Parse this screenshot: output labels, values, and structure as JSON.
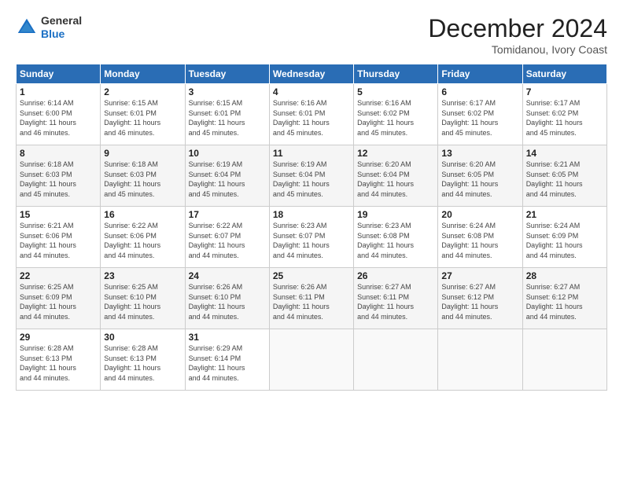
{
  "header": {
    "logo_line1": "General",
    "logo_line2": "Blue",
    "title": "December 2024",
    "location": "Tomidanou, Ivory Coast"
  },
  "weekdays": [
    "Sunday",
    "Monday",
    "Tuesday",
    "Wednesday",
    "Thursday",
    "Friday",
    "Saturday"
  ],
  "weeks": [
    [
      {
        "day": "1",
        "info": "Sunrise: 6:14 AM\nSunset: 6:00 PM\nDaylight: 11 hours\nand 46 minutes."
      },
      {
        "day": "2",
        "info": "Sunrise: 6:15 AM\nSunset: 6:01 PM\nDaylight: 11 hours\nand 46 minutes."
      },
      {
        "day": "3",
        "info": "Sunrise: 6:15 AM\nSunset: 6:01 PM\nDaylight: 11 hours\nand 45 minutes."
      },
      {
        "day": "4",
        "info": "Sunrise: 6:16 AM\nSunset: 6:01 PM\nDaylight: 11 hours\nand 45 minutes."
      },
      {
        "day": "5",
        "info": "Sunrise: 6:16 AM\nSunset: 6:02 PM\nDaylight: 11 hours\nand 45 minutes."
      },
      {
        "day": "6",
        "info": "Sunrise: 6:17 AM\nSunset: 6:02 PM\nDaylight: 11 hours\nand 45 minutes."
      },
      {
        "day": "7",
        "info": "Sunrise: 6:17 AM\nSunset: 6:02 PM\nDaylight: 11 hours\nand 45 minutes."
      }
    ],
    [
      {
        "day": "8",
        "info": "Sunrise: 6:18 AM\nSunset: 6:03 PM\nDaylight: 11 hours\nand 45 minutes."
      },
      {
        "day": "9",
        "info": "Sunrise: 6:18 AM\nSunset: 6:03 PM\nDaylight: 11 hours\nand 45 minutes."
      },
      {
        "day": "10",
        "info": "Sunrise: 6:19 AM\nSunset: 6:04 PM\nDaylight: 11 hours\nand 45 minutes."
      },
      {
        "day": "11",
        "info": "Sunrise: 6:19 AM\nSunset: 6:04 PM\nDaylight: 11 hours\nand 45 minutes."
      },
      {
        "day": "12",
        "info": "Sunrise: 6:20 AM\nSunset: 6:04 PM\nDaylight: 11 hours\nand 44 minutes."
      },
      {
        "day": "13",
        "info": "Sunrise: 6:20 AM\nSunset: 6:05 PM\nDaylight: 11 hours\nand 44 minutes."
      },
      {
        "day": "14",
        "info": "Sunrise: 6:21 AM\nSunset: 6:05 PM\nDaylight: 11 hours\nand 44 minutes."
      }
    ],
    [
      {
        "day": "15",
        "info": "Sunrise: 6:21 AM\nSunset: 6:06 PM\nDaylight: 11 hours\nand 44 minutes."
      },
      {
        "day": "16",
        "info": "Sunrise: 6:22 AM\nSunset: 6:06 PM\nDaylight: 11 hours\nand 44 minutes."
      },
      {
        "day": "17",
        "info": "Sunrise: 6:22 AM\nSunset: 6:07 PM\nDaylight: 11 hours\nand 44 minutes."
      },
      {
        "day": "18",
        "info": "Sunrise: 6:23 AM\nSunset: 6:07 PM\nDaylight: 11 hours\nand 44 minutes."
      },
      {
        "day": "19",
        "info": "Sunrise: 6:23 AM\nSunset: 6:08 PM\nDaylight: 11 hours\nand 44 minutes."
      },
      {
        "day": "20",
        "info": "Sunrise: 6:24 AM\nSunset: 6:08 PM\nDaylight: 11 hours\nand 44 minutes."
      },
      {
        "day": "21",
        "info": "Sunrise: 6:24 AM\nSunset: 6:09 PM\nDaylight: 11 hours\nand 44 minutes."
      }
    ],
    [
      {
        "day": "22",
        "info": "Sunrise: 6:25 AM\nSunset: 6:09 PM\nDaylight: 11 hours\nand 44 minutes."
      },
      {
        "day": "23",
        "info": "Sunrise: 6:25 AM\nSunset: 6:10 PM\nDaylight: 11 hours\nand 44 minutes."
      },
      {
        "day": "24",
        "info": "Sunrise: 6:26 AM\nSunset: 6:10 PM\nDaylight: 11 hours\nand 44 minutes."
      },
      {
        "day": "25",
        "info": "Sunrise: 6:26 AM\nSunset: 6:11 PM\nDaylight: 11 hours\nand 44 minutes."
      },
      {
        "day": "26",
        "info": "Sunrise: 6:27 AM\nSunset: 6:11 PM\nDaylight: 11 hours\nand 44 minutes."
      },
      {
        "day": "27",
        "info": "Sunrise: 6:27 AM\nSunset: 6:12 PM\nDaylight: 11 hours\nand 44 minutes."
      },
      {
        "day": "28",
        "info": "Sunrise: 6:27 AM\nSunset: 6:12 PM\nDaylight: 11 hours\nand 44 minutes."
      }
    ],
    [
      {
        "day": "29",
        "info": "Sunrise: 6:28 AM\nSunset: 6:13 PM\nDaylight: 11 hours\nand 44 minutes."
      },
      {
        "day": "30",
        "info": "Sunrise: 6:28 AM\nSunset: 6:13 PM\nDaylight: 11 hours\nand 44 minutes."
      },
      {
        "day": "31",
        "info": "Sunrise: 6:29 AM\nSunset: 6:14 PM\nDaylight: 11 hours\nand 44 minutes."
      },
      {
        "day": "",
        "info": ""
      },
      {
        "day": "",
        "info": ""
      },
      {
        "day": "",
        "info": ""
      },
      {
        "day": "",
        "info": ""
      }
    ]
  ]
}
